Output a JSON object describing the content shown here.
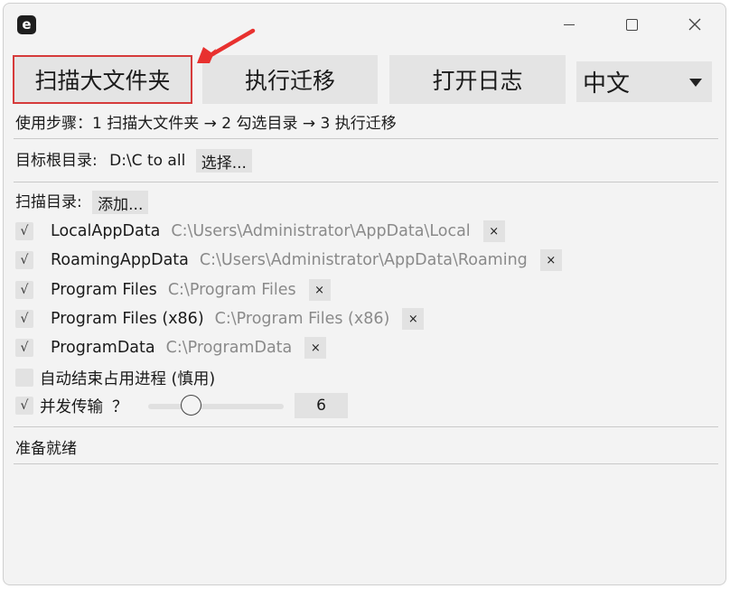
{
  "window": {
    "app_icon_letter": "e"
  },
  "toolbar": {
    "scan_label": "扫描大文件夹",
    "migrate_label": "执行迁移",
    "log_label": "打开日志",
    "language": "中文"
  },
  "steps_text": "使用步骤：1 扫描大文件夹 → 2 勾选目录 → 3 执行迁移",
  "target": {
    "label": "目标根目录:",
    "value": "D:\\C to all",
    "choose_label": "选择..."
  },
  "scan": {
    "label": "扫描目录:",
    "add_label": "添加...",
    "check_glyph": "√",
    "remove_glyph": "×",
    "dirs": [
      {
        "name": "LocalAppData",
        "path": "C:\\Users\\Administrator\\AppData\\Local",
        "checked": true
      },
      {
        "name": "RoamingAppData",
        "path": "C:\\Users\\Administrator\\AppData\\Roaming",
        "checked": true
      },
      {
        "name": "Program Files",
        "path": "C:\\Program Files",
        "checked": true
      },
      {
        "name": "Program Files (x86)",
        "path": "C:\\Program Files (x86)",
        "checked": true
      },
      {
        "name": "ProgramData",
        "path": "C:\\ProgramData",
        "checked": true
      }
    ]
  },
  "options": {
    "auto_kill_label": "自动结束占用进程 (慎用)",
    "auto_kill_checked": false,
    "concurrent_label": "并发传输",
    "concurrent_checked": true,
    "help_glyph": "？",
    "concurrency_value": "6",
    "slider_fraction": 0.3
  },
  "status": "准备就绪",
  "colors": {
    "highlight_border": "#d63b3b",
    "annotation_arrow": "#e8312f"
  }
}
